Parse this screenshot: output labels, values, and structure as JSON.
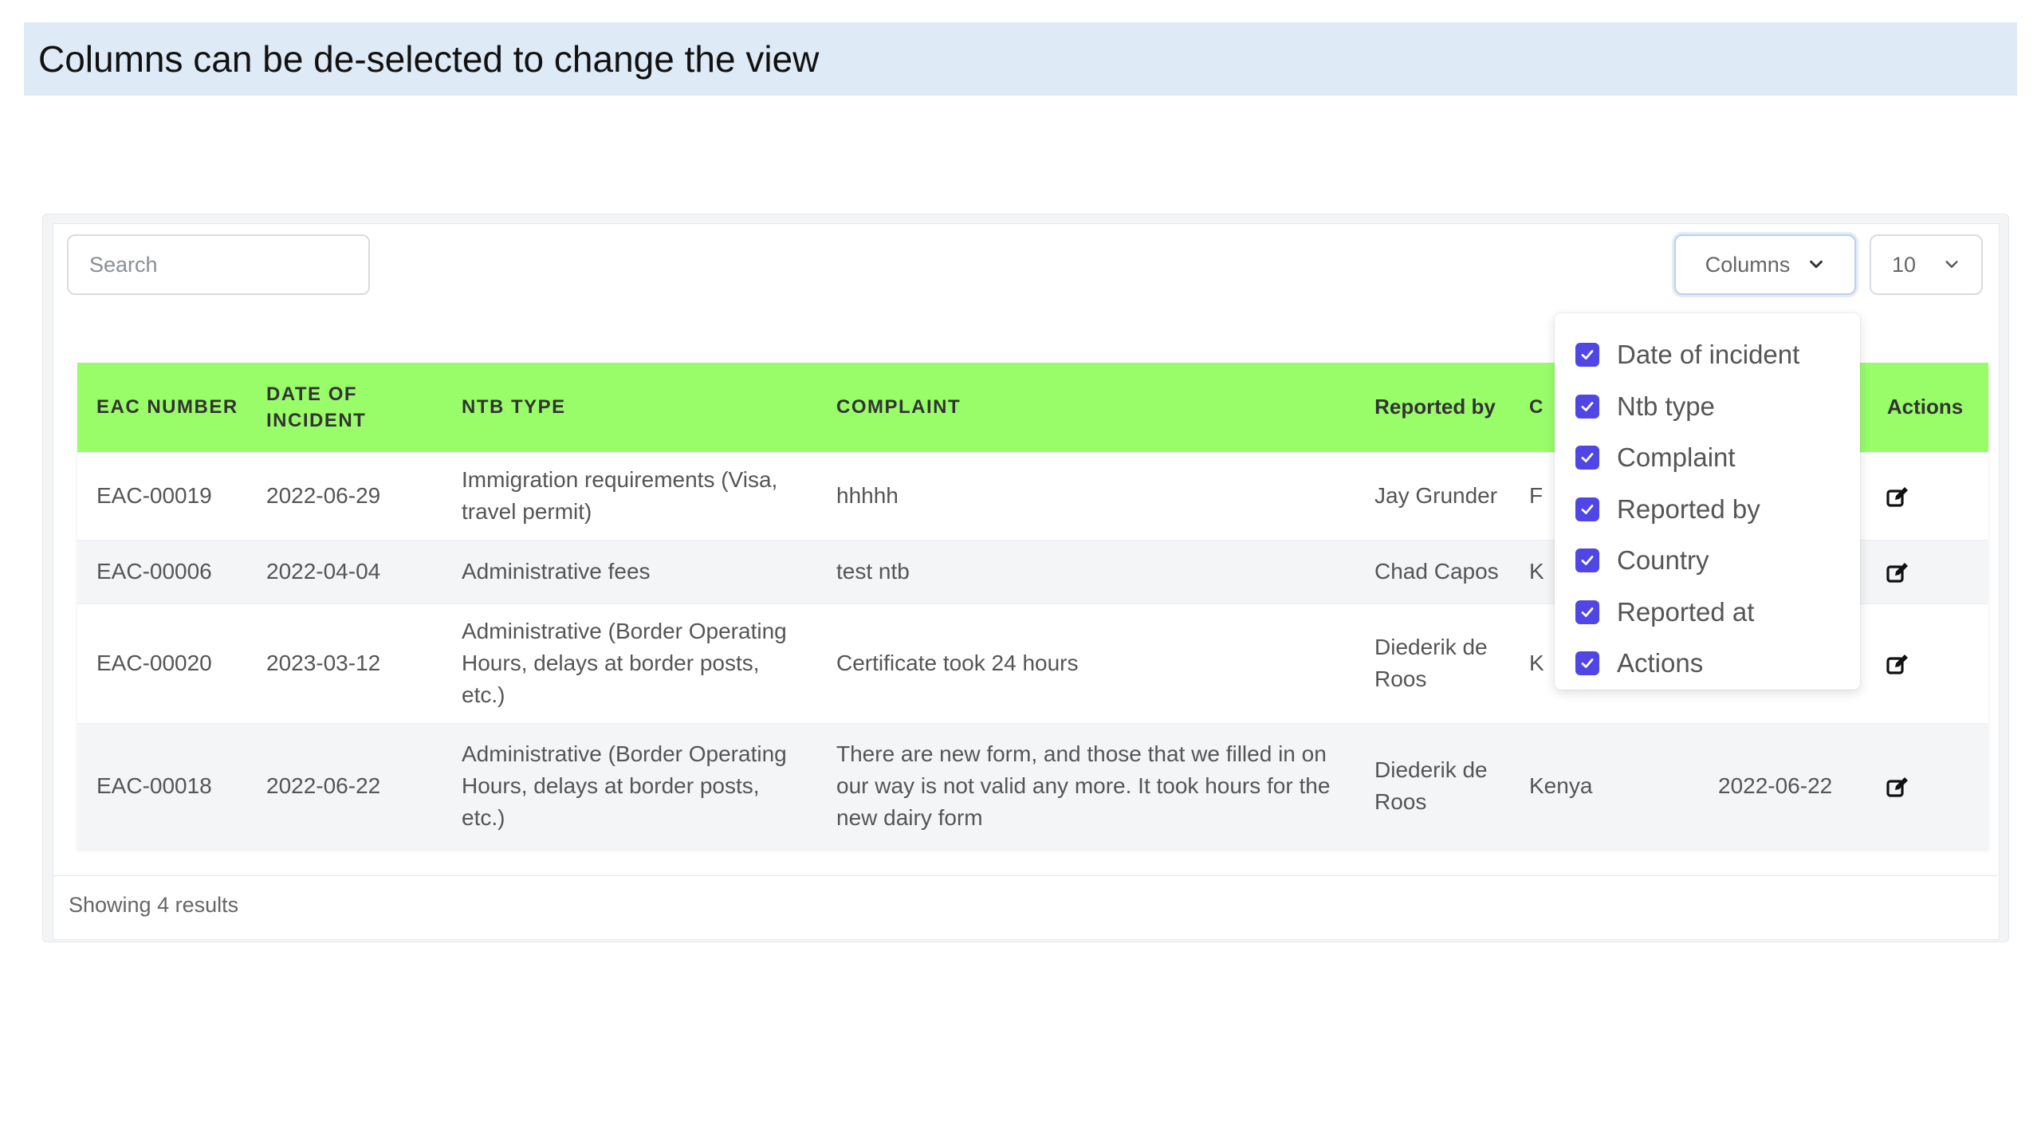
{
  "banner": {
    "text": "Columns can be de-selected to change the view"
  },
  "toolbar": {
    "search_placeholder": "Search",
    "columns_label": "Columns",
    "per_page_value": "10"
  },
  "table": {
    "headers": {
      "eac_number": "EAC NUMBER",
      "date_of_incident": "DATE OF INCIDENT",
      "ntb_type": "NTB TYPE",
      "complaint": "COMPLAINT",
      "reported_by": "Reported by",
      "country": "C",
      "reported_at": "",
      "actions": "Actions"
    },
    "rows": [
      {
        "eac": "EAC-00019",
        "date": "2022-06-29",
        "ntb": "Immigration requirements (Visa, travel permit)",
        "complaint": "hhhhh",
        "reporter": "Jay Grunder",
        "country": "F",
        "reported_at": "",
        "action_icon": "edit-icon"
      },
      {
        "eac": "EAC-00006",
        "date": "2022-04-04",
        "ntb": "Administrative fees",
        "complaint": "test ntb",
        "reporter": "Chad Capos",
        "country": "K",
        "reported_at": "",
        "action_icon": "edit-icon"
      },
      {
        "eac": "EAC-00020",
        "date": "2023-03-12",
        "ntb": "Administrative (Border Operating Hours, delays at border posts, etc.)",
        "complaint": "Certificate took 24 hours",
        "reporter": "Diederik de Roos",
        "country": "K",
        "reported_at": "",
        "action_icon": "edit-icon"
      },
      {
        "eac": "EAC-00018",
        "date": "2022-06-22",
        "ntb": "Administrative (Border Operating Hours, delays at border posts, etc.)",
        "complaint": "There are new form, and those that we filled in on our way is not valid any more. It took hours for the new dairy form",
        "reporter": "Diederik de Roos",
        "country": "Kenya",
        "reported_at": "2022-06-22",
        "action_icon": "edit-icon"
      }
    ]
  },
  "columns_menu": {
    "items": [
      {
        "label": "Date of incident",
        "checked": true
      },
      {
        "label": "Ntb type",
        "checked": true
      },
      {
        "label": "Complaint",
        "checked": true
      },
      {
        "label": "Reported by",
        "checked": true
      },
      {
        "label": "Country",
        "checked": true
      },
      {
        "label": "Reported at",
        "checked": true
      },
      {
        "label": "Actions",
        "checked": true
      }
    ]
  },
  "footer": {
    "results_text": "Showing 4 results"
  },
  "colors": {
    "header_bg": "#99fd6a",
    "checkbox": "#4f46e5",
    "banner_bg": "#deeaf6"
  }
}
